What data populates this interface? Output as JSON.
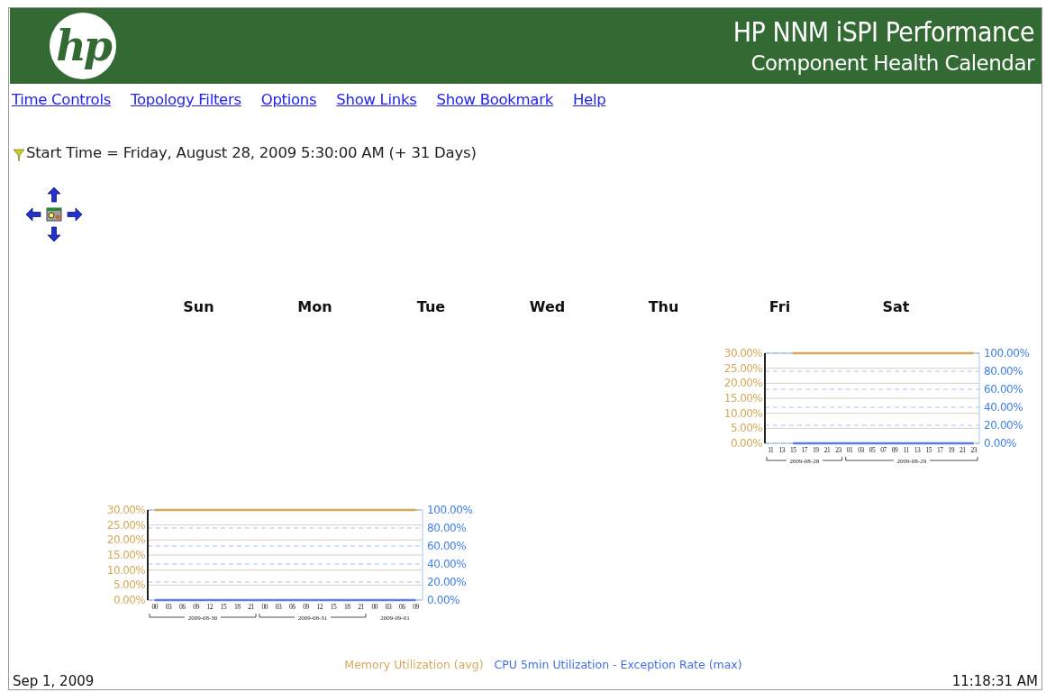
{
  "header": {
    "logo": "hp",
    "title": "HP NNM iSPI Performance",
    "subtitle": "Component Health Calendar"
  },
  "links": [
    "Time Controls",
    "Topology Filters",
    "Options",
    "Show Links",
    "Show Bookmark",
    "Help"
  ],
  "filter": {
    "text": "Start Time = Friday, August 28, 2009 5:30:00 AM (+ 31 Days)"
  },
  "calendar": {
    "days": [
      "Sun",
      "Mon",
      "Tue",
      "Wed",
      "Thu",
      "Fri",
      "Sat"
    ],
    "weeks": [
      {
        "cells": [
          {
            "kind": "empty"
          },
          {
            "kind": "empty"
          },
          {
            "kind": "empty"
          },
          {
            "kind": "empty"
          },
          {
            "kind": "empty"
          },
          {
            "kind": "chart",
            "chart_data": {
              "type": "line",
              "categories": [
                "11",
                "13",
                "15",
                "17",
                "19",
                "21",
                "23",
                "01",
                "03",
                "05",
                "07",
                "09",
                "11",
                "13",
                "15",
                "17",
                "19",
                "21",
                "23"
              ],
              "series": [
                {
                  "color": "#d4aa5a",
                  "values": [
                    null,
                    null,
                    30,
                    30,
                    30,
                    30,
                    30,
                    30,
                    30,
                    30,
                    30,
                    30,
                    30,
                    30,
                    30,
                    30,
                    30,
                    30,
                    30
                  ]
                },
                {
                  "color": "#5b7cf0",
                  "values": [
                    null,
                    null,
                    0,
                    0,
                    0,
                    0,
                    0,
                    0,
                    0,
                    0,
                    0,
                    0,
                    0,
                    0,
                    0,
                    0,
                    0,
                    0,
                    0
                  ]
                }
              ],
              "grid": true,
              "ylim": [
                0,
                30
              ],
              "yticks": [
                {
                  "value": 0,
                  "label": "0.00%"
                },
                {
                  "value": 5,
                  "label": "5.00%"
                },
                {
                  "value": 10,
                  "label": "10.00%"
                },
                {
                  "value": 15,
                  "label": "15.00%"
                },
                {
                  "value": 20,
                  "label": "20.00%"
                },
                {
                  "value": 25,
                  "label": "25.00%"
                },
                {
                  "value": 30,
                  "label": "30.00%"
                }
              ],
              "y2lim": [
                0,
                100
              ],
              "y2ticks": [
                {
                  "value": 0,
                  "label": "0.00%"
                },
                {
                  "value": 20,
                  "label": "20.00%"
                },
                {
                  "value": 40,
                  "label": "40.00%"
                },
                {
                  "value": 60,
                  "label": "60.00%"
                },
                {
                  "value": 80,
                  "label": "80.00%"
                },
                {
                  "value": 100,
                  "label": "100.00%"
                }
              ],
              "annotations": [
                "2009-08-28",
                "2009-08-29"
              ]
            }
          },
          {
            "kind": "empty"
          }
        ]
      },
      {
        "cells": [
          {
            "kind": "chart",
            "chart_data": {
              "type": "line",
              "categories": [
                "00",
                "03",
                "06",
                "09",
                "12",
                "15",
                "18",
                "21",
                "00",
                "03",
                "06",
                "09",
                "12",
                "15",
                "18",
                "21",
                "00",
                "03",
                "06",
                "09"
              ],
              "series": [
                {
                  "color": "#d4aa5a",
                  "values": [
                    30,
                    30,
                    30,
                    30,
                    30,
                    30,
                    30,
                    30,
                    30,
                    30,
                    30,
                    30,
                    30,
                    30,
                    30,
                    30,
                    30,
                    30,
                    30,
                    30
                  ]
                },
                {
                  "color": "#5b7cf0",
                  "values": [
                    0,
                    0,
                    0,
                    0,
                    0,
                    0,
                    0,
                    0,
                    0,
                    0,
                    0,
                    0,
                    0,
                    0,
                    0,
                    0,
                    0,
                    0,
                    0,
                    0
                  ]
                }
              ],
              "grid": true,
              "ylim": [
                0,
                30
              ],
              "yticks": [
                {
                  "value": 0,
                  "label": "0.00%"
                },
                {
                  "value": 5,
                  "label": "5.00%"
                },
                {
                  "value": 10,
                  "label": "10.00%"
                },
                {
                  "value": 15,
                  "label": "15.00%"
                },
                {
                  "value": 20,
                  "label": "20.00%"
                },
                {
                  "value": 25,
                  "label": "25.00%"
                },
                {
                  "value": 30,
                  "label": "30.00%"
                }
              ],
              "y2lim": [
                0,
                100
              ],
              "y2ticks": [
                {
                  "value": 0,
                  "label": "0.00%"
                },
                {
                  "value": 20,
                  "label": "20.00%"
                },
                {
                  "value": 40,
                  "label": "40.00%"
                },
                {
                  "value": 60,
                  "label": "60.00%"
                },
                {
                  "value": 80,
                  "label": "80.00%"
                },
                {
                  "value": 100,
                  "label": "100.00%"
                }
              ],
              "annotations": [
                "2009-08-30",
                "2009-08-31",
                "2009-09-01"
              ]
            }
          },
          {
            "kind": "empty"
          },
          {
            "kind": "empty"
          },
          {
            "kind": "empty"
          },
          {
            "kind": "empty"
          },
          {
            "kind": "empty"
          },
          {
            "kind": "empty"
          }
        ]
      }
    ]
  },
  "legend": [
    {
      "label": "Memory Utilization (avg)",
      "color": "#d4aa5a"
    },
    {
      "label": "CPU 5min Utilization - Exception Rate (max)",
      "color": "#3f6fe8"
    }
  ],
  "footer": {
    "date": "Sep 1, 2009",
    "time": "11:18:31 AM"
  }
}
